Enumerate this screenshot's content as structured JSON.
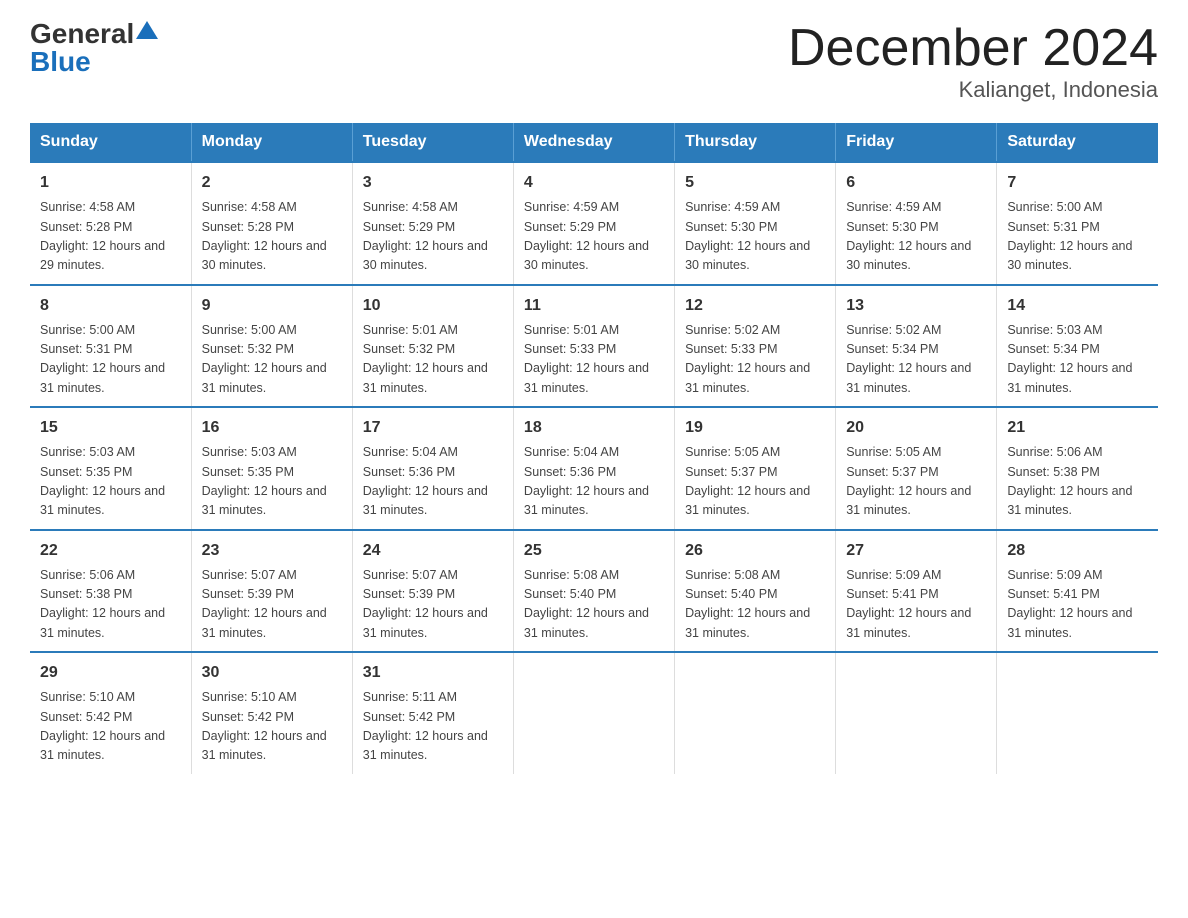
{
  "logo": {
    "general": "General",
    "blue": "Blue"
  },
  "title": "December 2024",
  "subtitle": "Kalianget, Indonesia",
  "days_of_week": [
    "Sunday",
    "Monday",
    "Tuesday",
    "Wednesday",
    "Thursday",
    "Friday",
    "Saturday"
  ],
  "weeks": [
    [
      {
        "day": "1",
        "sunrise": "4:58 AM",
        "sunset": "5:28 PM",
        "daylight": "12 hours and 29 minutes."
      },
      {
        "day": "2",
        "sunrise": "4:58 AM",
        "sunset": "5:28 PM",
        "daylight": "12 hours and 30 minutes."
      },
      {
        "day": "3",
        "sunrise": "4:58 AM",
        "sunset": "5:29 PM",
        "daylight": "12 hours and 30 minutes."
      },
      {
        "day": "4",
        "sunrise": "4:59 AM",
        "sunset": "5:29 PM",
        "daylight": "12 hours and 30 minutes."
      },
      {
        "day": "5",
        "sunrise": "4:59 AM",
        "sunset": "5:30 PM",
        "daylight": "12 hours and 30 minutes."
      },
      {
        "day": "6",
        "sunrise": "4:59 AM",
        "sunset": "5:30 PM",
        "daylight": "12 hours and 30 minutes."
      },
      {
        "day": "7",
        "sunrise": "5:00 AM",
        "sunset": "5:31 PM",
        "daylight": "12 hours and 30 minutes."
      }
    ],
    [
      {
        "day": "8",
        "sunrise": "5:00 AM",
        "sunset": "5:31 PM",
        "daylight": "12 hours and 31 minutes."
      },
      {
        "day": "9",
        "sunrise": "5:00 AM",
        "sunset": "5:32 PM",
        "daylight": "12 hours and 31 minutes."
      },
      {
        "day": "10",
        "sunrise": "5:01 AM",
        "sunset": "5:32 PM",
        "daylight": "12 hours and 31 minutes."
      },
      {
        "day": "11",
        "sunrise": "5:01 AM",
        "sunset": "5:33 PM",
        "daylight": "12 hours and 31 minutes."
      },
      {
        "day": "12",
        "sunrise": "5:02 AM",
        "sunset": "5:33 PM",
        "daylight": "12 hours and 31 minutes."
      },
      {
        "day": "13",
        "sunrise": "5:02 AM",
        "sunset": "5:34 PM",
        "daylight": "12 hours and 31 minutes."
      },
      {
        "day": "14",
        "sunrise": "5:03 AM",
        "sunset": "5:34 PM",
        "daylight": "12 hours and 31 minutes."
      }
    ],
    [
      {
        "day": "15",
        "sunrise": "5:03 AM",
        "sunset": "5:35 PM",
        "daylight": "12 hours and 31 minutes."
      },
      {
        "day": "16",
        "sunrise": "5:03 AM",
        "sunset": "5:35 PM",
        "daylight": "12 hours and 31 minutes."
      },
      {
        "day": "17",
        "sunrise": "5:04 AM",
        "sunset": "5:36 PM",
        "daylight": "12 hours and 31 minutes."
      },
      {
        "day": "18",
        "sunrise": "5:04 AM",
        "sunset": "5:36 PM",
        "daylight": "12 hours and 31 minutes."
      },
      {
        "day": "19",
        "sunrise": "5:05 AM",
        "sunset": "5:37 PM",
        "daylight": "12 hours and 31 minutes."
      },
      {
        "day": "20",
        "sunrise": "5:05 AM",
        "sunset": "5:37 PM",
        "daylight": "12 hours and 31 minutes."
      },
      {
        "day": "21",
        "sunrise": "5:06 AM",
        "sunset": "5:38 PM",
        "daylight": "12 hours and 31 minutes."
      }
    ],
    [
      {
        "day": "22",
        "sunrise": "5:06 AM",
        "sunset": "5:38 PM",
        "daylight": "12 hours and 31 minutes."
      },
      {
        "day": "23",
        "sunrise": "5:07 AM",
        "sunset": "5:39 PM",
        "daylight": "12 hours and 31 minutes."
      },
      {
        "day": "24",
        "sunrise": "5:07 AM",
        "sunset": "5:39 PM",
        "daylight": "12 hours and 31 minutes."
      },
      {
        "day": "25",
        "sunrise": "5:08 AM",
        "sunset": "5:40 PM",
        "daylight": "12 hours and 31 minutes."
      },
      {
        "day": "26",
        "sunrise": "5:08 AM",
        "sunset": "5:40 PM",
        "daylight": "12 hours and 31 minutes."
      },
      {
        "day": "27",
        "sunrise": "5:09 AM",
        "sunset": "5:41 PM",
        "daylight": "12 hours and 31 minutes."
      },
      {
        "day": "28",
        "sunrise": "5:09 AM",
        "sunset": "5:41 PM",
        "daylight": "12 hours and 31 minutes."
      }
    ],
    [
      {
        "day": "29",
        "sunrise": "5:10 AM",
        "sunset": "5:42 PM",
        "daylight": "12 hours and 31 minutes."
      },
      {
        "day": "30",
        "sunrise": "5:10 AM",
        "sunset": "5:42 PM",
        "daylight": "12 hours and 31 minutes."
      },
      {
        "day": "31",
        "sunrise": "5:11 AM",
        "sunset": "5:42 PM",
        "daylight": "12 hours and 31 minutes."
      },
      {
        "day": "",
        "sunrise": "",
        "sunset": "",
        "daylight": ""
      },
      {
        "day": "",
        "sunrise": "",
        "sunset": "",
        "daylight": ""
      },
      {
        "day": "",
        "sunrise": "",
        "sunset": "",
        "daylight": ""
      },
      {
        "day": "",
        "sunrise": "",
        "sunset": "",
        "daylight": ""
      }
    ]
  ]
}
